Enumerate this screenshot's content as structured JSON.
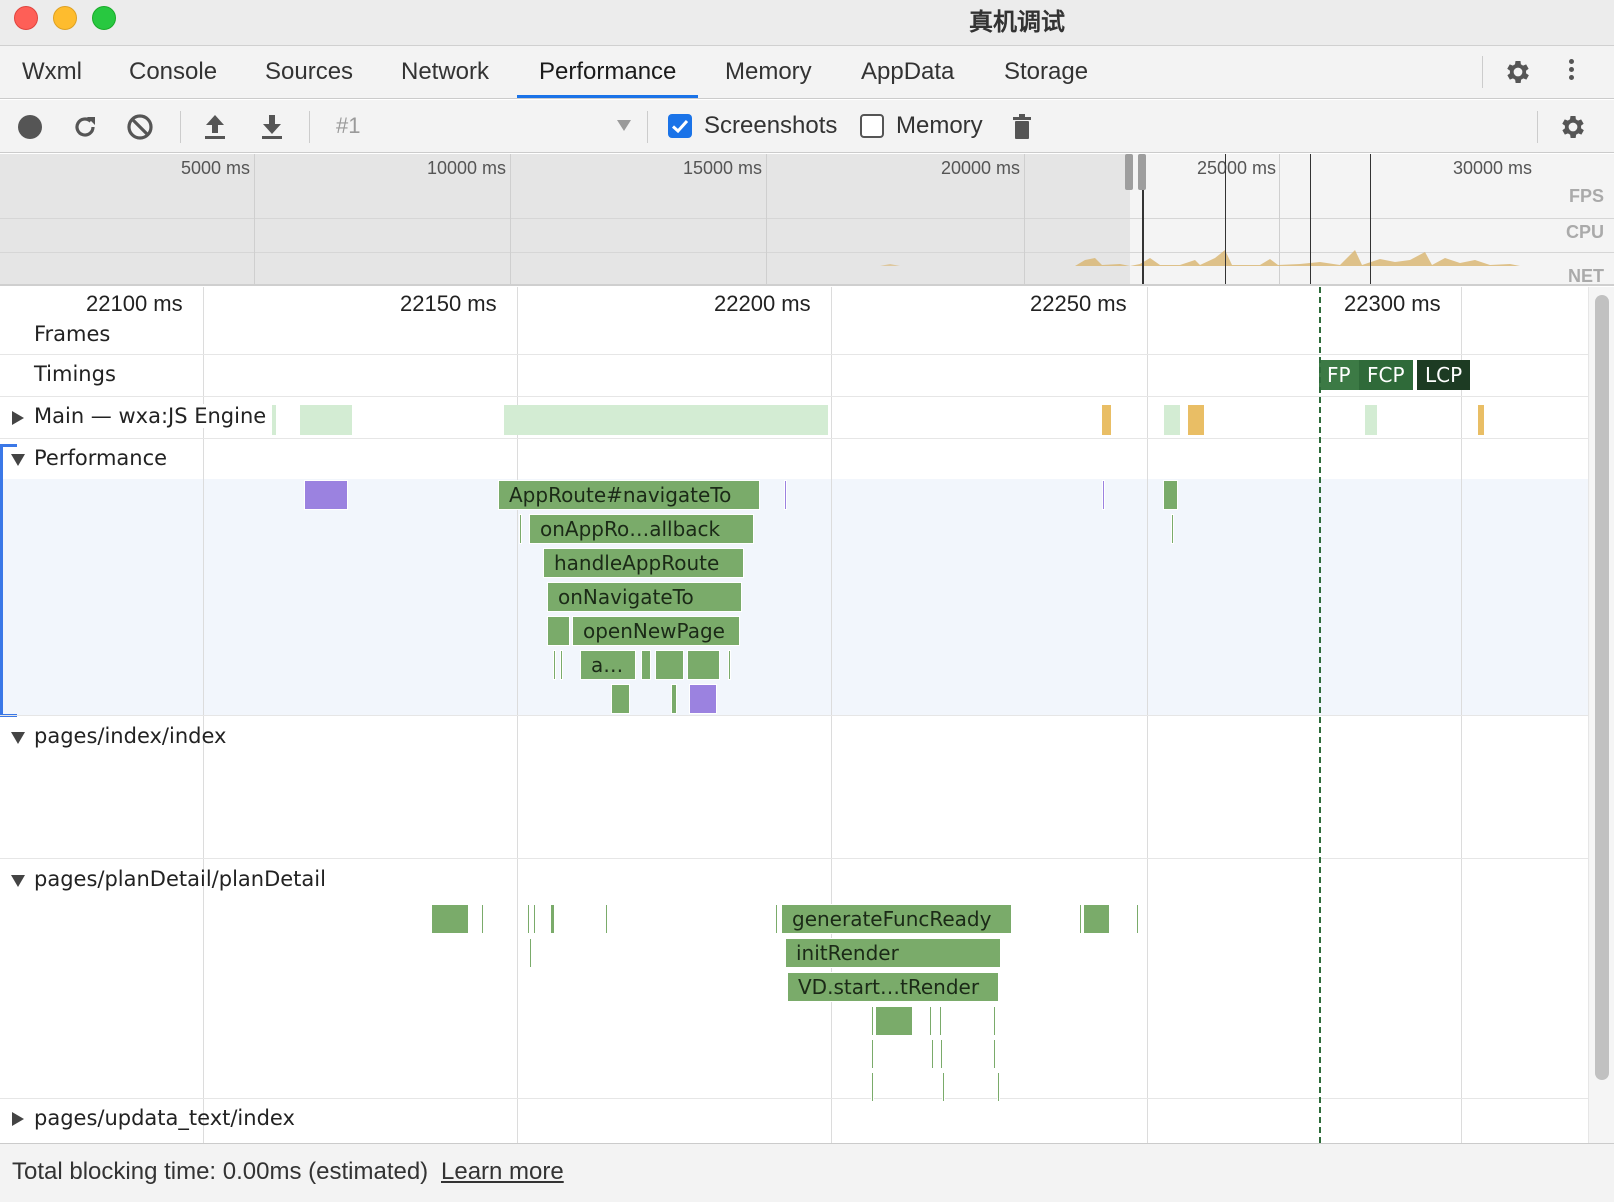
{
  "window": {
    "title": "真机调试"
  },
  "tabs": [
    {
      "label": "Wxml"
    },
    {
      "label": "Console"
    },
    {
      "label": "Sources"
    },
    {
      "label": "Network"
    },
    {
      "label": "Performance",
      "active": true
    },
    {
      "label": "Memory"
    },
    {
      "label": "AppData"
    },
    {
      "label": "Storage"
    }
  ],
  "toolbar": {
    "session": "#1",
    "screenshots_label": "Screenshots",
    "screenshots_checked": true,
    "memory_label": "Memory",
    "memory_checked": false
  },
  "overview": {
    "ticks": [
      "5000 ms",
      "10000 ms",
      "15000 ms",
      "20000 ms",
      "25000 ms",
      "30000 ms"
    ],
    "tracks": [
      "FPS",
      "CPU",
      "NET"
    ]
  },
  "flame": {
    "ticks": [
      "22100 ms",
      "22150 ms",
      "22200 ms",
      "22250 ms",
      "22300 ms"
    ],
    "tracks": {
      "frames": "Frames",
      "timings": "Timings",
      "main": "Main — wxa:JS Engine",
      "performance": "Performance",
      "index": "pages/index/index",
      "plan_detail": "pages/planDetail/planDetail",
      "updata": "pages/updata_text/index"
    },
    "timings": [
      "FP",
      "FCP",
      "LCP"
    ],
    "performance_events": {
      "e1": "AppRoute#navigateTo",
      "e2": "onAppRo…allback",
      "e3": "handleAppRoute",
      "e4": "onNavigateTo",
      "e5": "openNewPage",
      "e6": "a…"
    },
    "plan_detail_events": {
      "e1": "generateFuncReady",
      "e2": "initRender",
      "e3": "VD.start…tRender"
    }
  },
  "footer": {
    "text": "Total blocking time: 0.00ms (estimated)",
    "link": "Learn more"
  },
  "colors": {
    "accent": "#1a73e8",
    "event_green": "#7aab6a",
    "event_purple": "#9b82e0",
    "fp": "#3c7a45",
    "fcp": "#2f6a39",
    "lcp": "#1d3b23"
  }
}
